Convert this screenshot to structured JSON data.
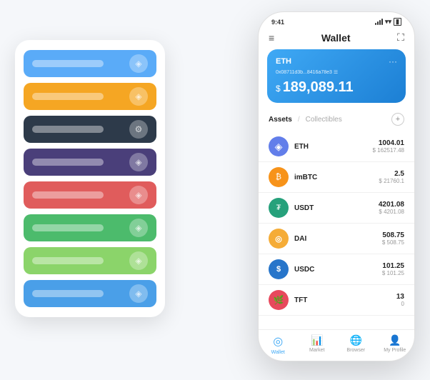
{
  "scene": {
    "cardStack": {
      "cards": [
        {
          "color": "card-blue",
          "icon": "◈"
        },
        {
          "color": "card-orange",
          "icon": "◈"
        },
        {
          "color": "card-dark",
          "icon": "⚙"
        },
        {
          "color": "card-purple",
          "icon": "◈"
        },
        {
          "color": "card-red",
          "icon": "◈"
        },
        {
          "color": "card-green",
          "icon": "◈"
        },
        {
          "color": "card-light-green",
          "icon": "◈"
        },
        {
          "color": "card-blue2",
          "icon": "◈"
        }
      ]
    },
    "phone": {
      "statusBar": {
        "time": "9:41",
        "batteryIcon": "▮"
      },
      "header": {
        "menuIcon": "≡",
        "title": "Wallet",
        "expandIcon": "⛶"
      },
      "ethCard": {
        "label": "ETH",
        "address": "0x08711d3b...8416a78e3 ☰",
        "moreIcon": "···",
        "currencySymbol": "$",
        "balance": "189,089.11"
      },
      "assets": {
        "activeTab": "Assets",
        "separator": "/",
        "inactiveTab": "Collectibles",
        "addIcon": "+"
      },
      "assetList": [
        {
          "name": "ETH",
          "icon": "◈",
          "iconBg": "eth-icon-circle",
          "iconColor": "white",
          "amount": "1004.01",
          "usd": "$ 162517.48"
        },
        {
          "name": "imBTC",
          "icon": "₿",
          "iconBg": "imbtc-icon-circle",
          "iconColor": "white",
          "amount": "2.5",
          "usd": "$ 21760.1"
        },
        {
          "name": "USDT",
          "icon": "₮",
          "iconBg": "usdt-icon-circle",
          "iconColor": "white",
          "amount": "4201.08",
          "usd": "$ 4201.08"
        },
        {
          "name": "DAI",
          "icon": "◎",
          "iconBg": "dai-icon-circle",
          "iconColor": "white",
          "amount": "508.75",
          "usd": "$ 508.75"
        },
        {
          "name": "USDC",
          "icon": "$",
          "iconBg": "usdc-icon-circle",
          "iconColor": "white",
          "amount": "101.25",
          "usd": "$ 101.25"
        },
        {
          "name": "TFT",
          "icon": "🌿",
          "iconBg": "tft-icon-circle",
          "iconColor": "white",
          "amount": "13",
          "usd": "0"
        }
      ],
      "bottomNav": [
        {
          "icon": "◎",
          "label": "Wallet",
          "active": true
        },
        {
          "icon": "📈",
          "label": "Market",
          "active": false
        },
        {
          "icon": "🌐",
          "label": "Browser",
          "active": false
        },
        {
          "icon": "👤",
          "label": "My Profile",
          "active": false
        }
      ]
    }
  }
}
